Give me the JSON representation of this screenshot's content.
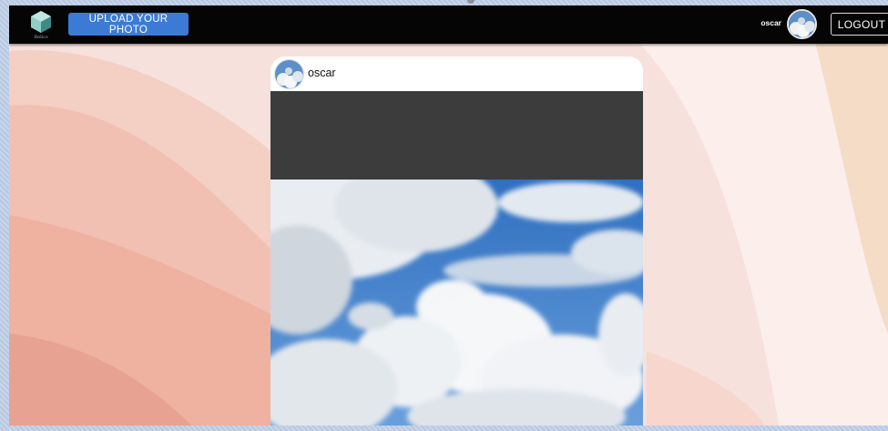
{
  "navbar": {
    "logo_icon": "cube-logo-icon",
    "logo_text": "Relics",
    "upload_label": "UPLOAD YOUR PHOTO",
    "username": "oscar",
    "avatar_icon": "sky-avatar-icon",
    "logout_label": "LOGOUT"
  },
  "post": {
    "username": "oscar",
    "avatar_icon": "sky-avatar-icon",
    "photo_icon": "cloudy-sky-photo"
  },
  "colors": {
    "navbar_bg": "#050505",
    "upload_button": "#3b7bd6",
    "card_bg": "#ffffff",
    "dark_band": "#3c3c3c",
    "sky_blue": "#3f7fcc"
  }
}
